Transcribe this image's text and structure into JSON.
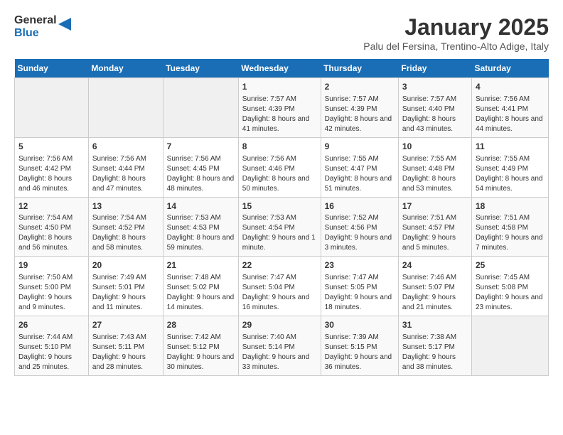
{
  "header": {
    "logo_general": "General",
    "logo_blue": "Blue",
    "title": "January 2025",
    "subtitle": "Palu del Fersina, Trentino-Alto Adige, Italy"
  },
  "days_of_week": [
    "Sunday",
    "Monday",
    "Tuesday",
    "Wednesday",
    "Thursday",
    "Friday",
    "Saturday"
  ],
  "weeks": [
    [
      {
        "day": "",
        "info": ""
      },
      {
        "day": "",
        "info": ""
      },
      {
        "day": "",
        "info": ""
      },
      {
        "day": "1",
        "info": "Sunrise: 7:57 AM\nSunset: 4:39 PM\nDaylight: 8 hours and 41 minutes."
      },
      {
        "day": "2",
        "info": "Sunrise: 7:57 AM\nSunset: 4:39 PM\nDaylight: 8 hours and 42 minutes."
      },
      {
        "day": "3",
        "info": "Sunrise: 7:57 AM\nSunset: 4:40 PM\nDaylight: 8 hours and 43 minutes."
      },
      {
        "day": "4",
        "info": "Sunrise: 7:56 AM\nSunset: 4:41 PM\nDaylight: 8 hours and 44 minutes."
      }
    ],
    [
      {
        "day": "5",
        "info": "Sunrise: 7:56 AM\nSunset: 4:42 PM\nDaylight: 8 hours and 46 minutes."
      },
      {
        "day": "6",
        "info": "Sunrise: 7:56 AM\nSunset: 4:44 PM\nDaylight: 8 hours and 47 minutes."
      },
      {
        "day": "7",
        "info": "Sunrise: 7:56 AM\nSunset: 4:45 PM\nDaylight: 8 hours and 48 minutes."
      },
      {
        "day": "8",
        "info": "Sunrise: 7:56 AM\nSunset: 4:46 PM\nDaylight: 8 hours and 50 minutes."
      },
      {
        "day": "9",
        "info": "Sunrise: 7:55 AM\nSunset: 4:47 PM\nDaylight: 8 hours and 51 minutes."
      },
      {
        "day": "10",
        "info": "Sunrise: 7:55 AM\nSunset: 4:48 PM\nDaylight: 8 hours and 53 minutes."
      },
      {
        "day": "11",
        "info": "Sunrise: 7:55 AM\nSunset: 4:49 PM\nDaylight: 8 hours and 54 minutes."
      }
    ],
    [
      {
        "day": "12",
        "info": "Sunrise: 7:54 AM\nSunset: 4:50 PM\nDaylight: 8 hours and 56 minutes."
      },
      {
        "day": "13",
        "info": "Sunrise: 7:54 AM\nSunset: 4:52 PM\nDaylight: 8 hours and 58 minutes."
      },
      {
        "day": "14",
        "info": "Sunrise: 7:53 AM\nSunset: 4:53 PM\nDaylight: 8 hours and 59 minutes."
      },
      {
        "day": "15",
        "info": "Sunrise: 7:53 AM\nSunset: 4:54 PM\nDaylight: 9 hours and 1 minute."
      },
      {
        "day": "16",
        "info": "Sunrise: 7:52 AM\nSunset: 4:56 PM\nDaylight: 9 hours and 3 minutes."
      },
      {
        "day": "17",
        "info": "Sunrise: 7:51 AM\nSunset: 4:57 PM\nDaylight: 9 hours and 5 minutes."
      },
      {
        "day": "18",
        "info": "Sunrise: 7:51 AM\nSunset: 4:58 PM\nDaylight: 9 hours and 7 minutes."
      }
    ],
    [
      {
        "day": "19",
        "info": "Sunrise: 7:50 AM\nSunset: 5:00 PM\nDaylight: 9 hours and 9 minutes."
      },
      {
        "day": "20",
        "info": "Sunrise: 7:49 AM\nSunset: 5:01 PM\nDaylight: 9 hours and 11 minutes."
      },
      {
        "day": "21",
        "info": "Sunrise: 7:48 AM\nSunset: 5:02 PM\nDaylight: 9 hours and 14 minutes."
      },
      {
        "day": "22",
        "info": "Sunrise: 7:47 AM\nSunset: 5:04 PM\nDaylight: 9 hours and 16 minutes."
      },
      {
        "day": "23",
        "info": "Sunrise: 7:47 AM\nSunset: 5:05 PM\nDaylight: 9 hours and 18 minutes."
      },
      {
        "day": "24",
        "info": "Sunrise: 7:46 AM\nSunset: 5:07 PM\nDaylight: 9 hours and 21 minutes."
      },
      {
        "day": "25",
        "info": "Sunrise: 7:45 AM\nSunset: 5:08 PM\nDaylight: 9 hours and 23 minutes."
      }
    ],
    [
      {
        "day": "26",
        "info": "Sunrise: 7:44 AM\nSunset: 5:10 PM\nDaylight: 9 hours and 25 minutes."
      },
      {
        "day": "27",
        "info": "Sunrise: 7:43 AM\nSunset: 5:11 PM\nDaylight: 9 hours and 28 minutes."
      },
      {
        "day": "28",
        "info": "Sunrise: 7:42 AM\nSunset: 5:12 PM\nDaylight: 9 hours and 30 minutes."
      },
      {
        "day": "29",
        "info": "Sunrise: 7:40 AM\nSunset: 5:14 PM\nDaylight: 9 hours and 33 minutes."
      },
      {
        "day": "30",
        "info": "Sunrise: 7:39 AM\nSunset: 5:15 PM\nDaylight: 9 hours and 36 minutes."
      },
      {
        "day": "31",
        "info": "Sunrise: 7:38 AM\nSunset: 5:17 PM\nDaylight: 9 hours and 38 minutes."
      },
      {
        "day": "",
        "info": ""
      }
    ]
  ]
}
